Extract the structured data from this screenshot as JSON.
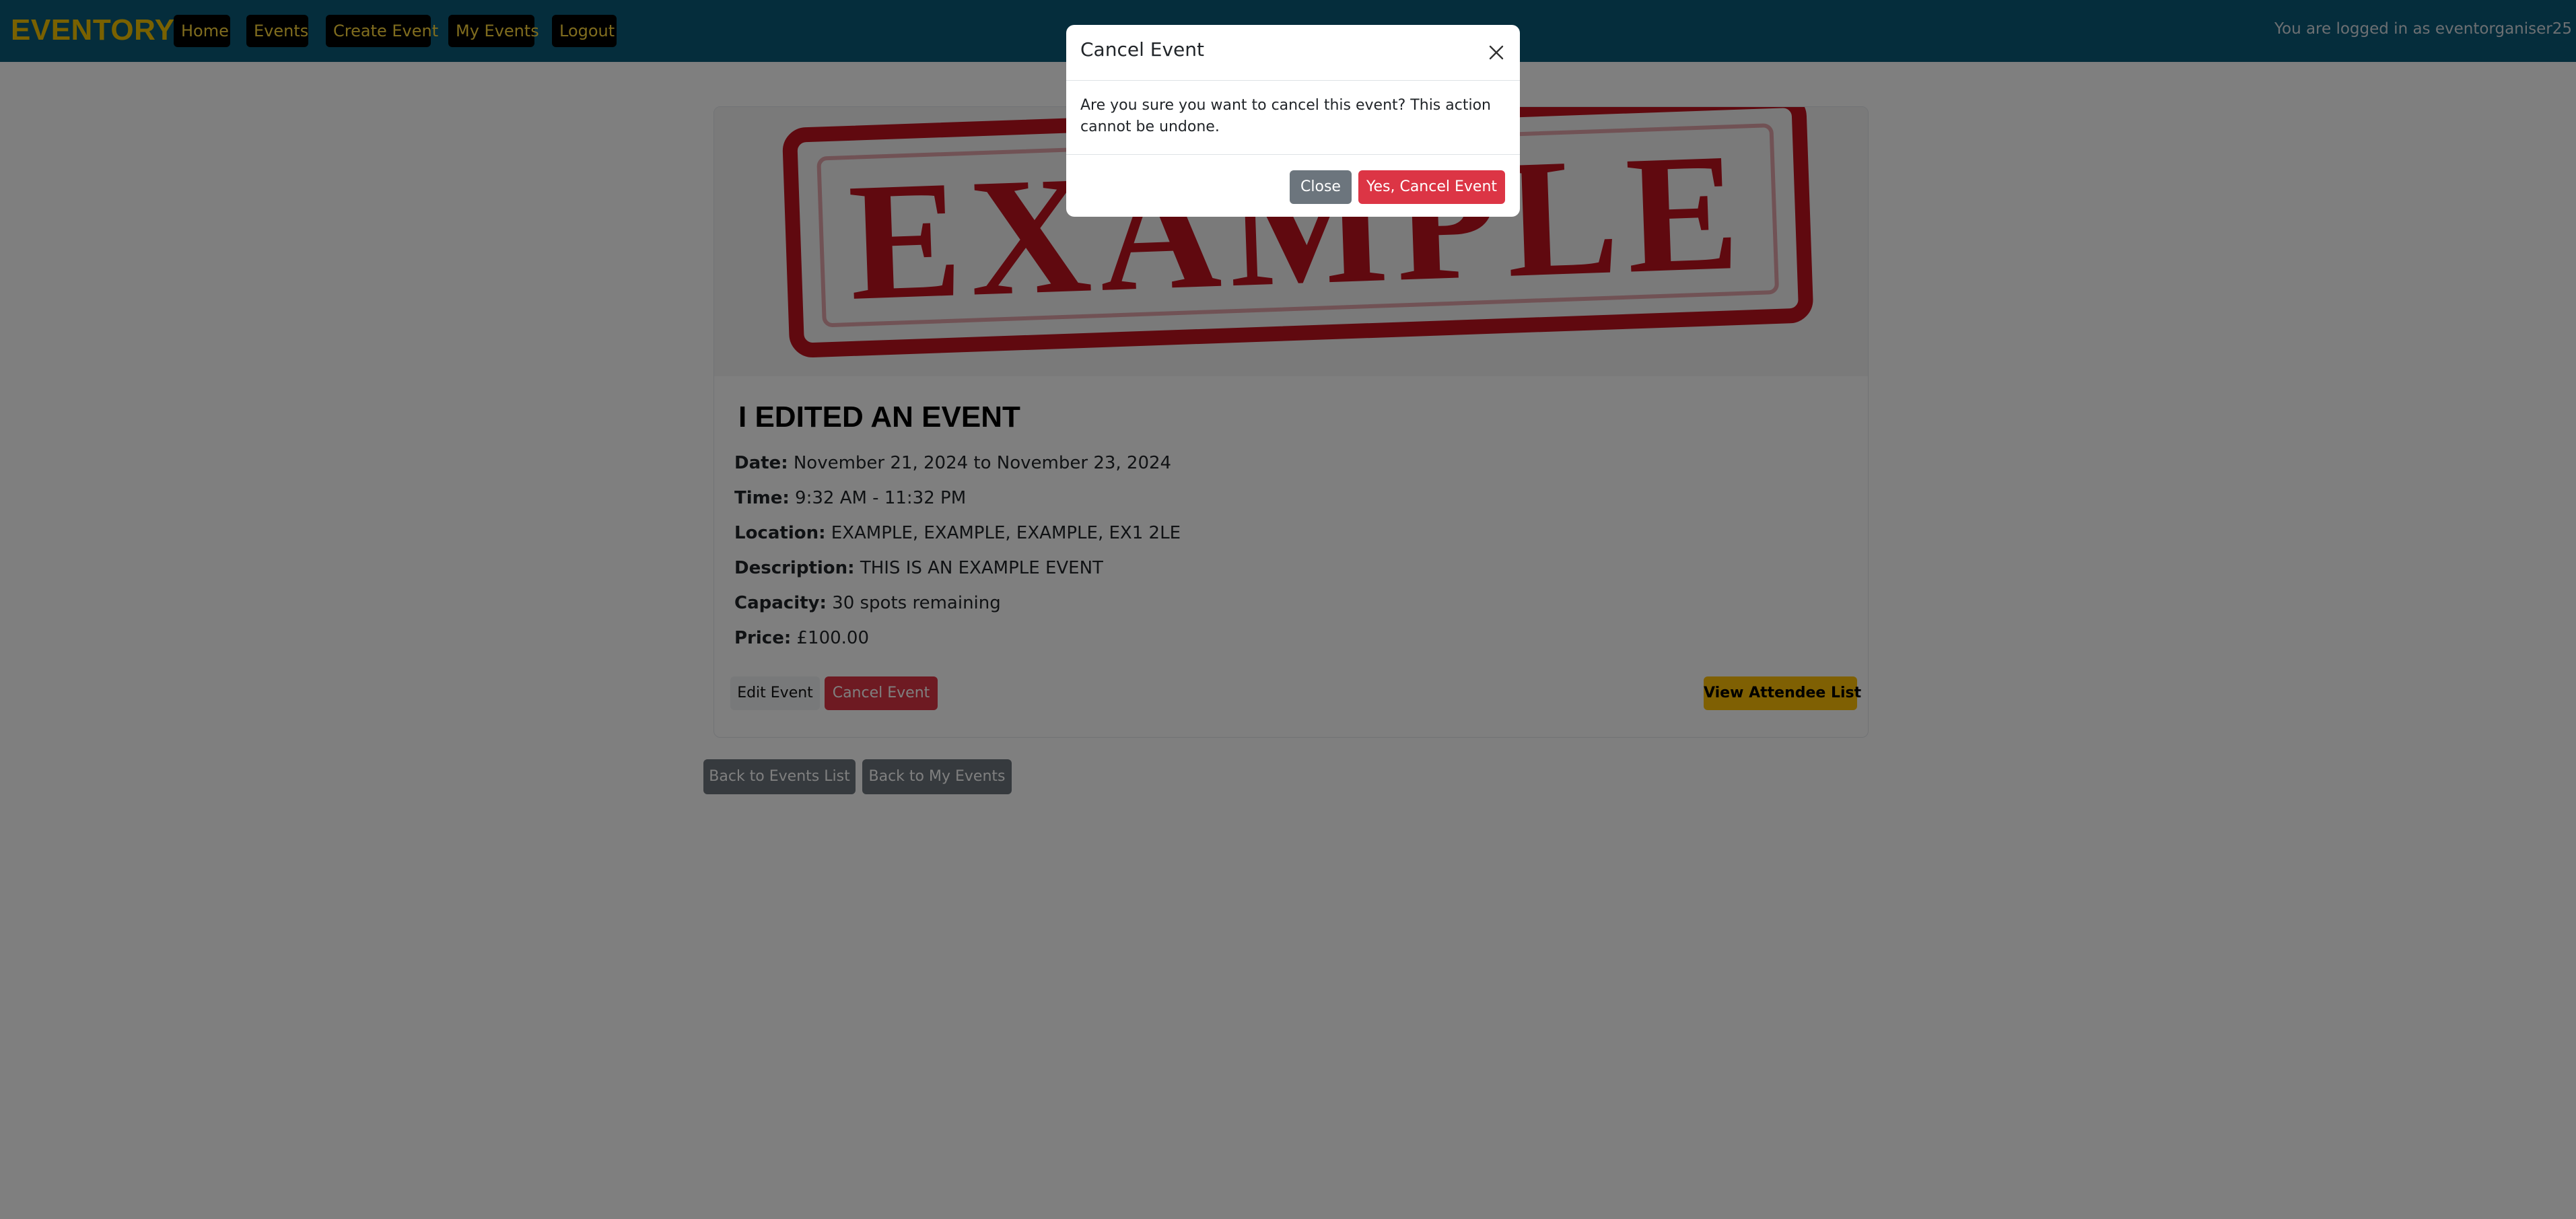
{
  "navbar": {
    "brand": "EVENTORY",
    "items": [
      {
        "label": "Home"
      },
      {
        "label": "Events"
      },
      {
        "label": "Create Event"
      },
      {
        "label": "My Events"
      },
      {
        "label": "Logout"
      }
    ],
    "logged_in_text": "You are logged in as eventorganiser25"
  },
  "event": {
    "image_text": "EXAMPLE",
    "title": "I EDITED AN EVENT",
    "details": [
      {
        "label": "Date:",
        "value": "November 21, 2024 to November 23, 2024"
      },
      {
        "label": "Time:",
        "value": "9:32 AM - 11:32 PM"
      },
      {
        "label": "Location:",
        "value": "EXAMPLE, EXAMPLE, EXAMPLE, EX1 2LE"
      },
      {
        "label": "Description:",
        "value": "THIS IS AN EXAMPLE EVENT"
      },
      {
        "label": "Capacity:",
        "value": "30 spots remaining"
      },
      {
        "label": "Price:",
        "value": "£100.00"
      }
    ],
    "edit_label": "Edit Event",
    "cancel_label": "Cancel Event",
    "attendee_label": "View Attendee List"
  },
  "back": {
    "events_list": "Back to Events List",
    "my_events": "Back to My Events"
  },
  "modal": {
    "title": "Cancel Event",
    "body": "Are you sure you want to cancel this event? This action cannot be undone.",
    "close_label": "Close",
    "confirm_label": "Yes, Cancel Event"
  },
  "colors": {
    "navbar": "#0b5a78",
    "brand": "#f2c200",
    "danger": "#dc3545",
    "warning": "#ffc107",
    "secondary": "#6c757d",
    "stamp": "#c1121f"
  }
}
